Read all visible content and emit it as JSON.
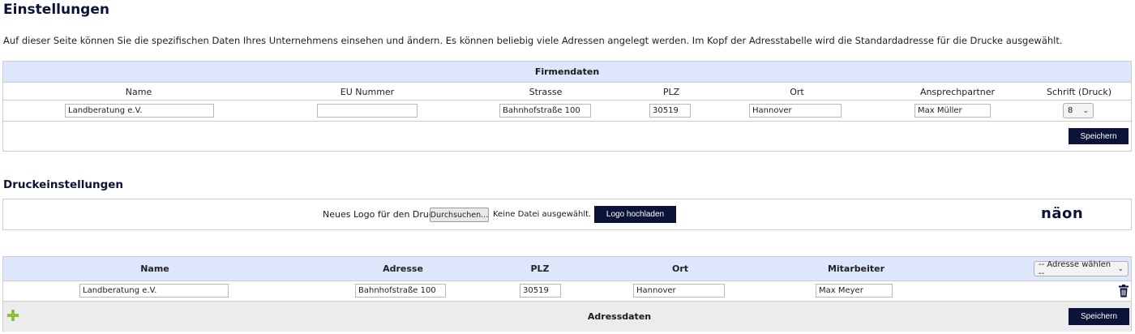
{
  "page": {
    "title": "Einstellungen",
    "intro": "Auf dieser Seite können Sie die spezifischen Daten Ihres Unternehmens einsehen und ändern. Es können beliebig viele Adressen angelegt werden. Im Kopf der Adresstabelle wird die Standardadresse für die Drucke ausgewählt."
  },
  "company": {
    "heading": "Firmendaten",
    "columns": [
      "Name",
      "EU Nummer",
      "Strasse",
      "PLZ",
      "Ort",
      "Ansprechpartner",
      "Schrift (Druck)"
    ],
    "values": {
      "name": "Landberatung e.V.",
      "eu_number": "",
      "street": "Bahnhofstraße 100",
      "zip": "30519",
      "city": "Hannover",
      "contact": "Max Müller",
      "font_size": "8"
    },
    "save_label": "Speichern"
  },
  "print": {
    "heading": "Druckeinstellungen",
    "logo_label": "Neues Logo für den Druck:",
    "browse_label": "Durchsuchen...",
    "no_file_label": "Keine Datei ausgewählt.",
    "upload_label": "Logo hochladen",
    "logo_text": "näon"
  },
  "addresses": {
    "columns": [
      "Name",
      "Adresse",
      "PLZ",
      "Ort",
      "Mitarbeiter"
    ],
    "select_placeholder": "-- Adresse wählen --",
    "rows": [
      {
        "name": "Landberatung e.V.",
        "address": "Bahnhofstraße 100",
        "zip": "30519",
        "city": "Hannover",
        "employee": "Max Meyer"
      }
    ],
    "footer_label": "Adressdaten",
    "save_label": "Speichern"
  },
  "colors": {
    "accent": "#0b1338",
    "header_bg": "#dde6fb",
    "add_icon": "#8bbf3c"
  },
  "icons": [
    "add-icon",
    "trash-icon",
    "chevron-down-icon"
  ]
}
